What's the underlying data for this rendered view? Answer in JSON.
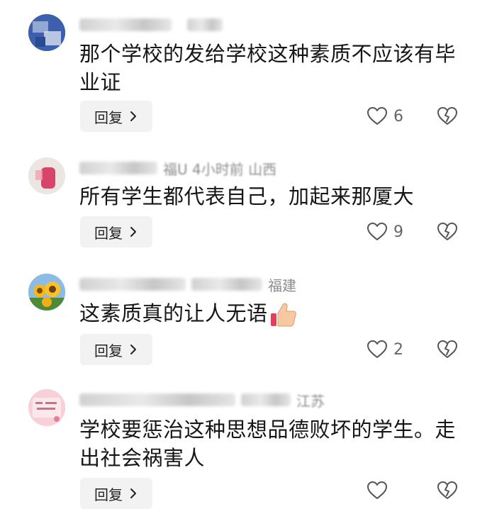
{
  "comments": [
    {
      "meta_text": "",
      "text_line1": "那个学校的发给学校这种素质不应该有毕",
      "text_line2": "业证",
      "reply_label": "回复",
      "likes": "6",
      "avatar_color": "#3f67b5"
    },
    {
      "meta_text": "福U  4小时前  山西",
      "text_line1": "所有学生都代表自己，加起来那厦大",
      "reply_label": "回复",
      "likes": "9",
      "avatar_color": "#d84d6a"
    },
    {
      "meta_text": "福建",
      "text_line1": "这素质真的让人无语",
      "reply_label": "回复",
      "likes": "2",
      "avatar_color": "#f2b32b"
    },
    {
      "meta_text": "江苏",
      "text_line1": "学校要惩治这种思想品德败坏的学生。走",
      "text_line2": "出社会祸害人",
      "reply_label": "回复",
      "likes": "",
      "avatar_color": "#f6c9d3"
    }
  ],
  "icons": {
    "like": "heart-outline-icon",
    "dislike": "broken-heart-icon",
    "reply_chevron": "chevron-right-icon"
  },
  "colors": {
    "reply_bg": "#f2f2f2",
    "secondary_text": "#8c8c8c",
    "primary_text": "#161616"
  }
}
